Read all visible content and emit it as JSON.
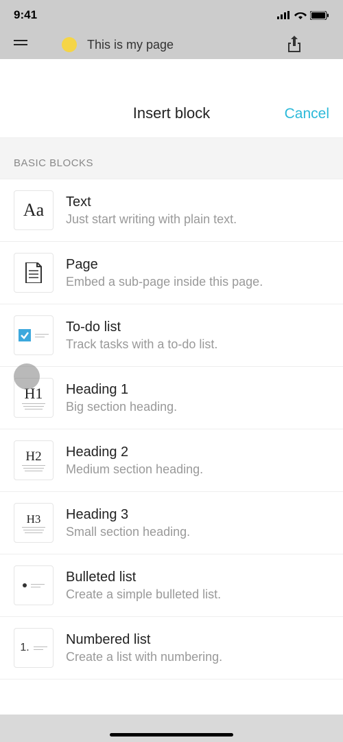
{
  "status": {
    "time": "9:41"
  },
  "background_page": {
    "title": "This is my page"
  },
  "modal": {
    "title": "Insert block",
    "cancel": "Cancel",
    "section": "BASIC BLOCKS",
    "blocks": [
      {
        "icon": "Aa",
        "title": "Text",
        "desc": "Just start writing with plain text."
      },
      {
        "icon": "page",
        "title": "Page",
        "desc": "Embed a sub-page inside this page."
      },
      {
        "icon": "todo",
        "title": "To-do list",
        "desc": "Track tasks with a to-do list."
      },
      {
        "icon": "H1",
        "title": "Heading 1",
        "desc": "Big section heading."
      },
      {
        "icon": "H2",
        "title": "Heading 2",
        "desc": "Medium section heading."
      },
      {
        "icon": "H3",
        "title": "Heading 3",
        "desc": "Small section heading."
      },
      {
        "icon": "bullet",
        "title": "Bulleted list",
        "desc": "Create a simple bulleted list."
      },
      {
        "icon": "number",
        "title": "Numbered list",
        "desc": "Create a list with numbering."
      }
    ]
  }
}
